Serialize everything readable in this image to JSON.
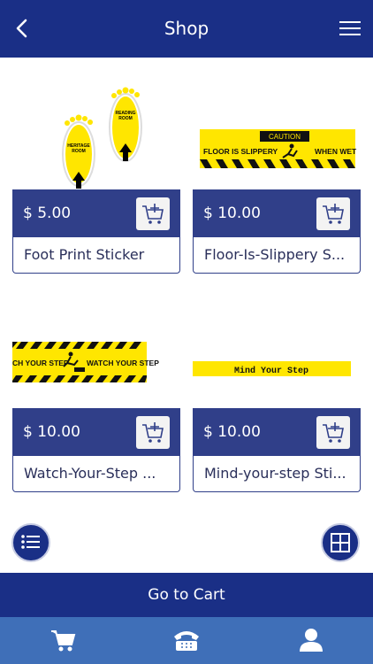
{
  "header": {
    "title": "Shop",
    "back_icon": "chevron-left-icon",
    "menu_icon": "hamburger-menu-icon"
  },
  "products": [
    {
      "price": "$ 5.00",
      "name": "Foot Print Sticker",
      "image": "footprint-sticker-image",
      "img_text": [
        "HERITAGE",
        "ROOM",
        "READING",
        "ROOM"
      ]
    },
    {
      "price": "$ 10.00",
      "name": "Floor-Is-Slippery S...",
      "image": "caution-floor-slippery-image",
      "img_text": [
        "CAUTION",
        "FLOOR IS SLIPPERY",
        "WHEN WET"
      ]
    },
    {
      "price": "$ 10.00",
      "name": "Watch-Your-Step ...",
      "image": "watch-your-step-image",
      "img_text": [
        "CH YOUR STEP",
        "WATCH YOUR STEP"
      ]
    },
    {
      "price": "$ 10.00",
      "name": "Mind-your-step Sti...",
      "image": "mind-your-step-image",
      "img_text": [
        "Mind   Your   Step"
      ]
    }
  ],
  "floating": {
    "list_view_icon": "list-view-icon",
    "grid_view_icon": "grid-view-icon"
  },
  "go_to_cart": "Go to Cart",
  "tabbar": {
    "items": [
      "cart-icon",
      "phone-icon",
      "user-icon"
    ]
  },
  "colors": {
    "primary": "#1a2f86",
    "price_bar": "#303f89",
    "tabbar": "#3f6fb8",
    "sticker_yellow": "#ffe600"
  }
}
